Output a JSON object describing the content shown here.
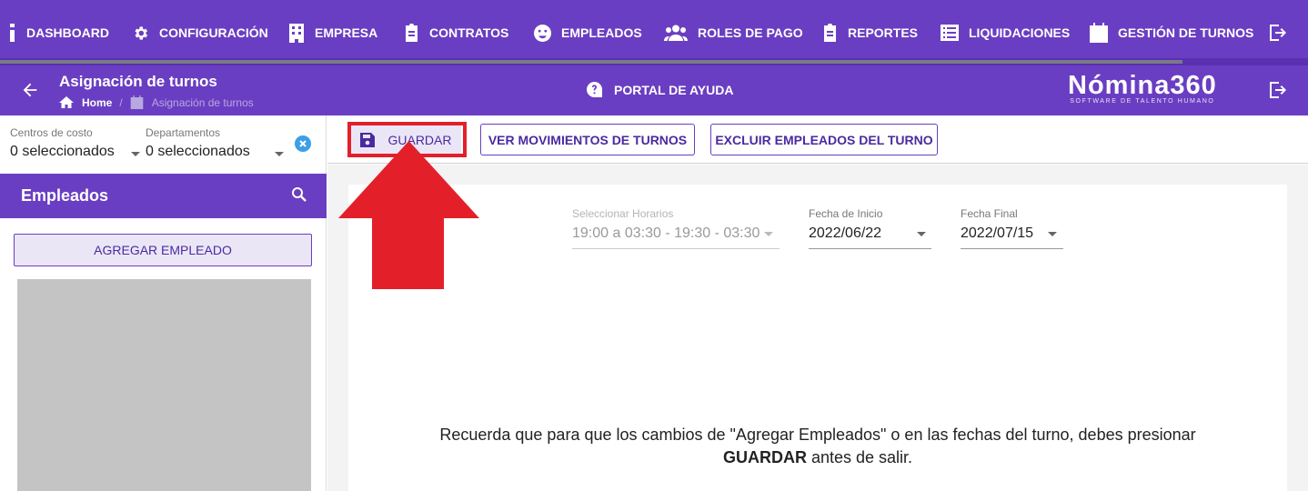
{
  "nav": {
    "items": [
      {
        "label": "DASHBOARD",
        "icon": "dashboard-icon"
      },
      {
        "label": "CONFIGURACIÓN",
        "icon": "gear-icon"
      },
      {
        "label": "EMPRESA",
        "icon": "building-icon"
      },
      {
        "label": "CONTRATOS",
        "icon": "clipboard-icon"
      },
      {
        "label": "EMPLEADOS",
        "icon": "face-icon"
      },
      {
        "label": "ROLES DE PAGO",
        "icon": "users-icon"
      },
      {
        "label": "REPORTES",
        "icon": "clipboard-icon"
      },
      {
        "label": "LIQUIDACIONES",
        "icon": "list-icon"
      },
      {
        "label": "GESTIÓN DE TURNOS",
        "icon": "calendar-icon"
      }
    ]
  },
  "header": {
    "title": "Asignación de turnos",
    "breadcrumb_home": "Home",
    "breadcrumb_sep": "/",
    "breadcrumb_current": "Asignación de turnos",
    "help_label": "PORTAL DE AYUDA",
    "brand_name": "Nómina360",
    "brand_tagline": "SOFTWARE DE TALENTO HUMANO"
  },
  "filters": {
    "cost_centers_label": "Centros de costo",
    "cost_centers_value": "0 seleccionados",
    "departments_label": "Departamentos",
    "departments_value": "0 seleccionados"
  },
  "employees": {
    "title": "Empleados",
    "add_button": "AGREGAR EMPLEADO"
  },
  "toolbar": {
    "save_label": "GUARDAR",
    "movements_label": "VER MOVIMIENTOS DE TURNOS",
    "exclude_label": "EXCLUIR EMPLEADOS DEL TURNO"
  },
  "form": {
    "schedule_label": "Seleccionar Horarios",
    "schedule_value": "19:00 a 03:30 - 19:30 - 03:30",
    "start_label": "Fecha de Inicio",
    "start_value": "2022/06/22",
    "end_label": "Fecha Final",
    "end_value": "2022/07/15"
  },
  "notice": {
    "line1": "Recuerda que para que los cambios de \"Agregar Empleados\" o en las fechas del turno, debes presionar",
    "bold": "GUARDAR",
    "line2_rest": " antes de salir."
  },
  "colors": {
    "brand_purple": "#6a3ec2",
    "annotation_red": "#e3202a"
  }
}
